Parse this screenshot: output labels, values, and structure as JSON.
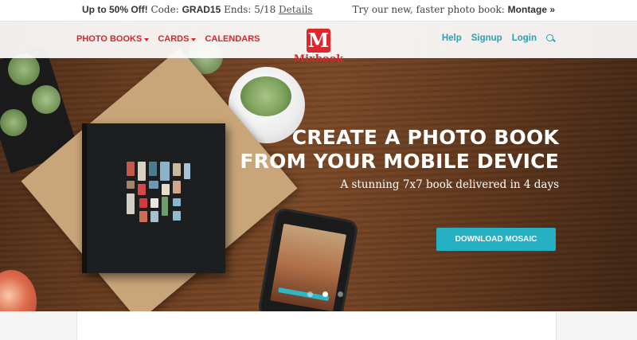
{
  "promo": {
    "offer": "Up to 50% Off!",
    "code_label": "Code:",
    "code": "GRAD15",
    "ends": "Ends: 5/18",
    "details": "Details",
    "right_text": "Try our new, faster photo book:",
    "right_link": "Montage »"
  },
  "nav": {
    "left_items": [
      {
        "label": "PHOTO BOOKS",
        "dropdown": true
      },
      {
        "label": "CARDS",
        "dropdown": true
      },
      {
        "label": "CALENDARS",
        "dropdown": false
      }
    ],
    "logo_mark": "M",
    "logo_text": "Mixbook",
    "right_items": [
      {
        "label": "Help"
      },
      {
        "label": "Signup"
      },
      {
        "label": "Login"
      }
    ],
    "search_icon": "search-icon"
  },
  "hero": {
    "title_line1": "CREATE A PHOTO BOOK",
    "title_line2": "FROM YOUR MOBILE DEVICE",
    "subtitle": "A stunning 7x7 book delivered in 4 days",
    "cta": "DOWNLOAD MOSAIC",
    "slides": 3,
    "active_slide": 2
  },
  "colors": {
    "brand_red": "#d8262b",
    "accent_teal": "#26b0c4",
    "link_teal": "#2a9fb4"
  }
}
